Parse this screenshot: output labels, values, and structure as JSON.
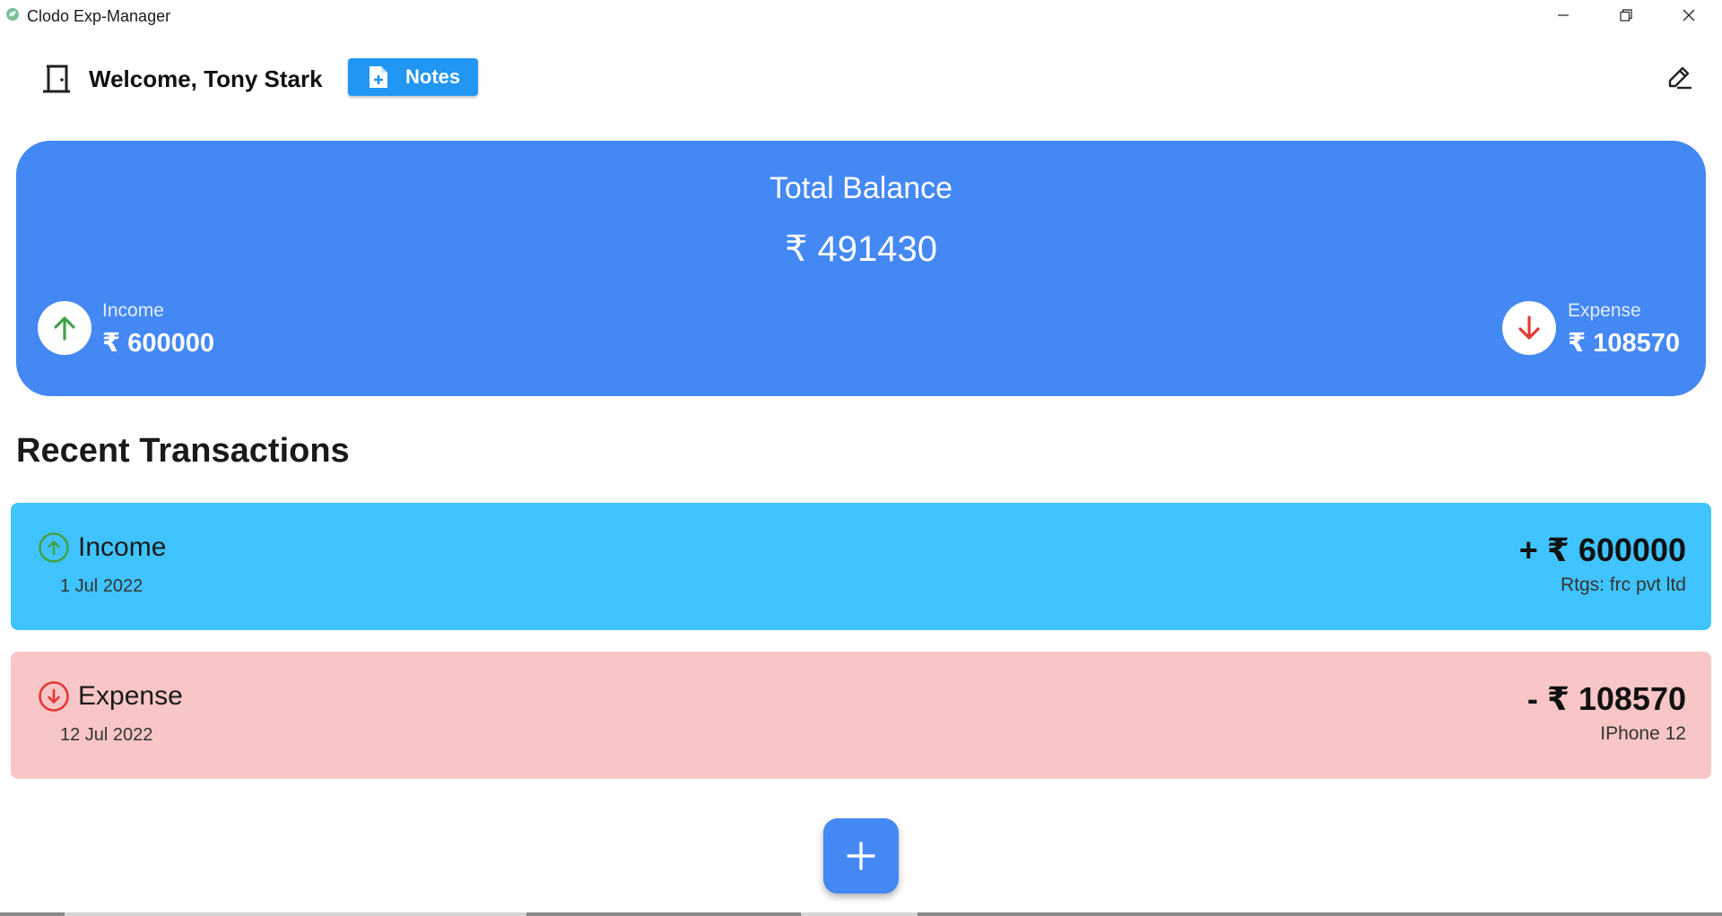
{
  "window": {
    "title": "Clodo Exp-Manager",
    "icon": "leaf-app-icon"
  },
  "header": {
    "welcome": "Welcome, Tony Stark",
    "notes_label": "Notes"
  },
  "balance": {
    "title": "Total Balance",
    "total": "₹ 491430",
    "income_label": "Income",
    "income_value": "₹ 600000",
    "expense_label": "Expense",
    "expense_value": "₹ 108570"
  },
  "recent": {
    "title": "Recent Transactions",
    "items": [
      {
        "type": "Income",
        "date": "1 Jul 2022",
        "amount": "+ ₹ 600000",
        "note": "Rtgs: frc pvt ltd"
      },
      {
        "type": "Expense",
        "date": "12 Jul 2022",
        "amount": "- ₹ 108570",
        "note": "IPhone 12"
      }
    ]
  },
  "colors": {
    "accent": "#4488f4",
    "notes_button": "#2196f3",
    "income_card": "#40c4ff",
    "expense_card": "#f8c6c6",
    "income_arrow": "#43a047",
    "expense_arrow": "#e53935"
  }
}
